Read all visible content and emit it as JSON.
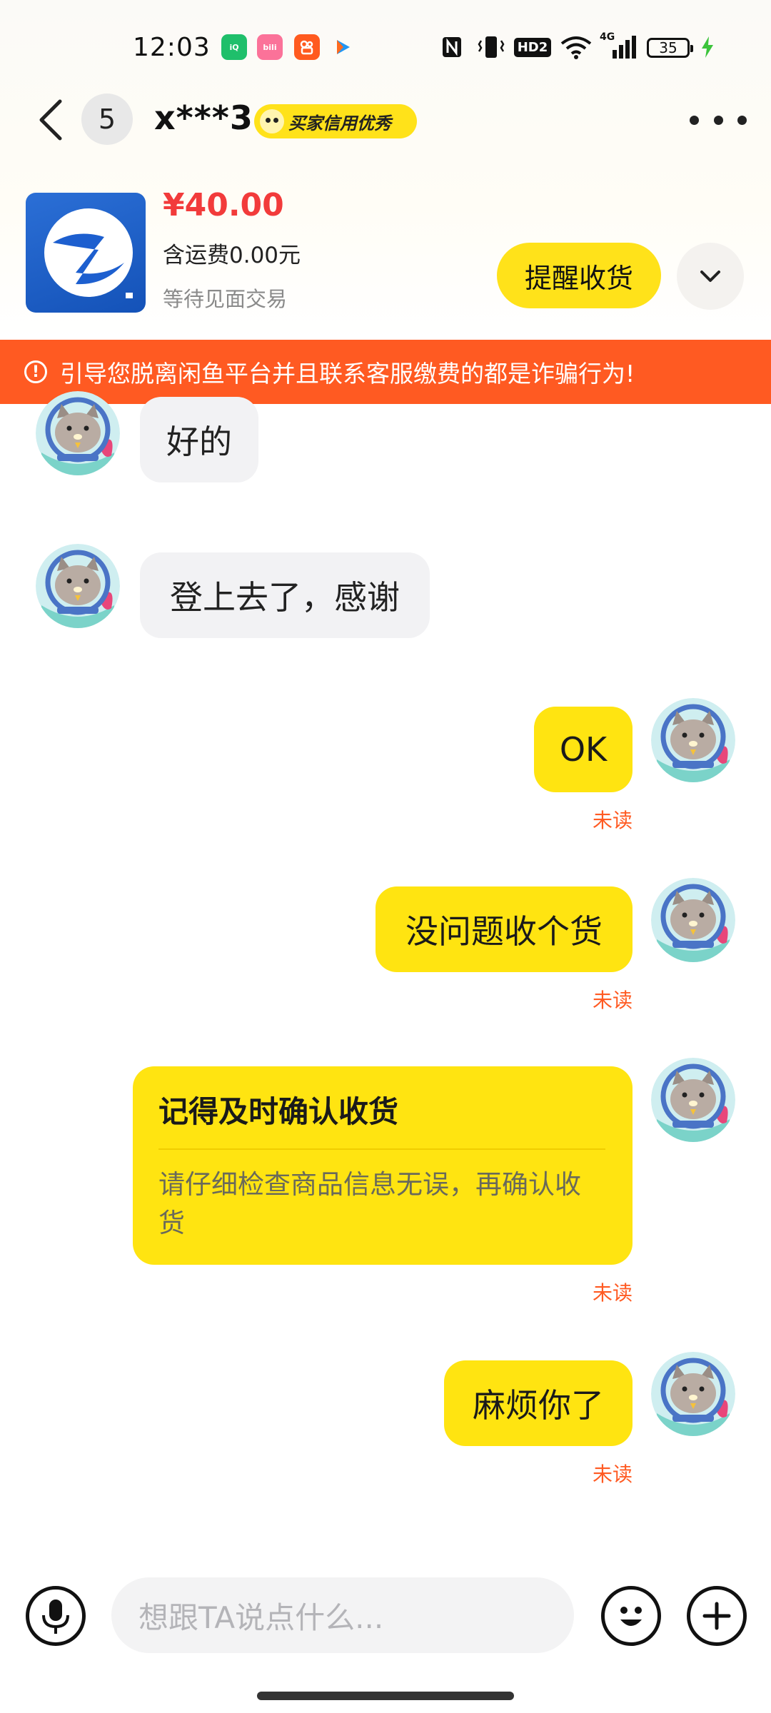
{
  "status_bar": {
    "time": "12:03",
    "app_icons": [
      "iqiyi-icon",
      "bilibili-icon",
      "kuaishou-icon",
      "youku-icon"
    ],
    "network": "4G",
    "battery": "35",
    "hd_label": "HD2"
  },
  "header": {
    "unread_count": "5",
    "username": "x***3",
    "credit_badge": "买家信用优秀"
  },
  "product": {
    "price": "¥40.00",
    "shipping": "含运费0.00元",
    "status": "等待见面交易",
    "remind_button": "提醒收货"
  },
  "warning": {
    "text": "引导您脱离闲鱼平台并且联系客服缴费的都是诈骗行为!"
  },
  "messages": [
    {
      "direction": "in",
      "text": "好的"
    },
    {
      "direction": "in",
      "text": "登上去了，感谢"
    },
    {
      "direction": "out",
      "text": "OK",
      "status": "未读"
    },
    {
      "direction": "out",
      "text": "没问题收个货",
      "status": "未读"
    },
    {
      "direction": "out",
      "type": "card",
      "title": "记得及时确认收货",
      "body": "请仔细检查商品信息无误，再确认收货",
      "status": "未读"
    },
    {
      "direction": "out",
      "text": "麻烦你了",
      "status": "未读"
    }
  ],
  "input": {
    "placeholder": "想跟TA说点什么..."
  },
  "colors": {
    "accent_yellow": "#ffe411",
    "warning_orange": "#ff5a22",
    "price_red": "#f23b3b"
  }
}
